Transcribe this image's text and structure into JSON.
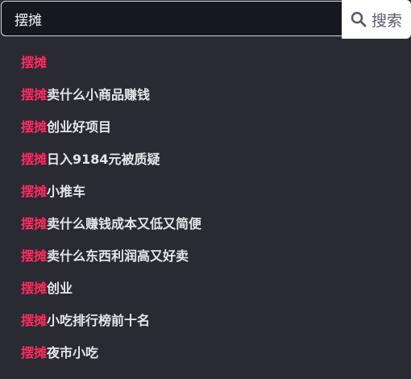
{
  "search": {
    "query": "摆摊",
    "button_label": "搜索",
    "button_icon": "search-icon"
  },
  "suggestions": [
    {
      "highlight": "摆摊",
      "rest": ""
    },
    {
      "highlight": "摆摊",
      "rest": "卖什么小商品赚钱"
    },
    {
      "highlight": "摆摊",
      "rest": "创业好项目"
    },
    {
      "highlight": "摆摊",
      "rest": "日入9184元被质疑"
    },
    {
      "highlight": "摆摊",
      "rest": "小推车"
    },
    {
      "highlight": "摆摊",
      "rest": "卖什么赚钱成本又低又简便"
    },
    {
      "highlight": "摆摊",
      "rest": "卖什么东西利润高又好卖"
    },
    {
      "highlight": "摆摊",
      "rest": "创业"
    },
    {
      "highlight": "摆摊",
      "rest": "小吃排行榜前十名"
    },
    {
      "highlight": "摆摊",
      "rest": "夜市小吃"
    }
  ],
  "colors": {
    "highlight": "#ff2b5e",
    "background": "#2a2a33",
    "input_background": "#171720"
  }
}
